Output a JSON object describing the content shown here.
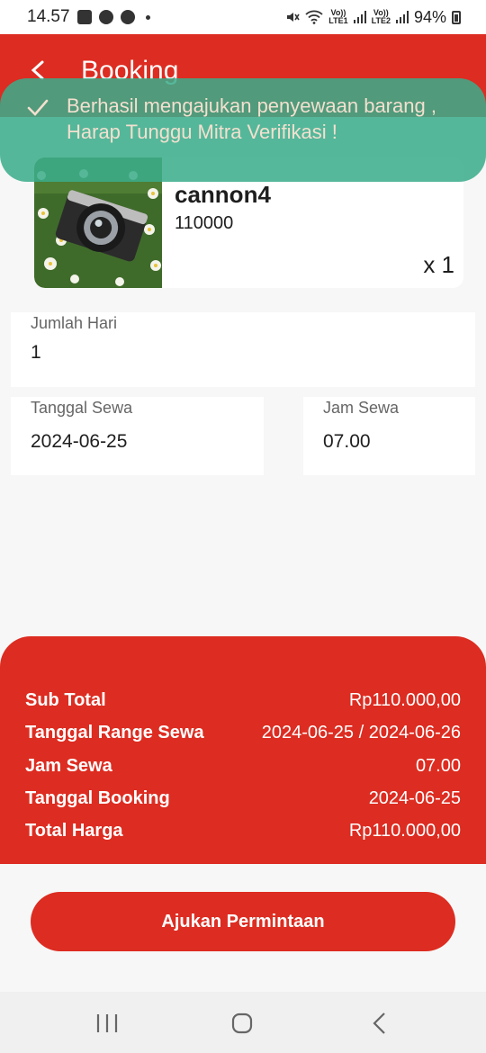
{
  "status_bar": {
    "time": "14.57",
    "battery": "94%",
    "lte1": "LTE1",
    "lte2": "LTE2",
    "vo": "Vo))"
  },
  "header": {
    "title": "Booking",
    "back_icon": "chevron-left-icon"
  },
  "toast": {
    "message": "Berhasil mengajukan penyewaan barang , Harap Tunggu Mitra Verifikasi !",
    "icon": "check-icon"
  },
  "product": {
    "name": "cannon4",
    "price": "110000",
    "quantity": "x 1"
  },
  "form": {
    "days": {
      "label": "Jumlah Hari",
      "value": "1"
    },
    "rent_date": {
      "label": "Tanggal Sewa",
      "value": "2024-06-25"
    },
    "rent_time": {
      "label": "Jam Sewa",
      "value": "07.00"
    }
  },
  "summary": {
    "rows": [
      {
        "label": "Sub Total",
        "value": "Rp110.000,00"
      },
      {
        "label": "Tanggal Range Sewa",
        "value": "2024-06-25 / 2024-06-26"
      },
      {
        "label": "Jam Sewa",
        "value": "07.00"
      },
      {
        "label": "Tanggal Booking",
        "value": "2024-06-25"
      },
      {
        "label": "Total Harga",
        "value": "Rp110.000,00"
      }
    ]
  },
  "actions": {
    "submit_label": "Ajukan Permintaan"
  },
  "colors": {
    "primary": "#dd2c21",
    "toast": "#3aac8a",
    "background": "#f7f7f7"
  }
}
